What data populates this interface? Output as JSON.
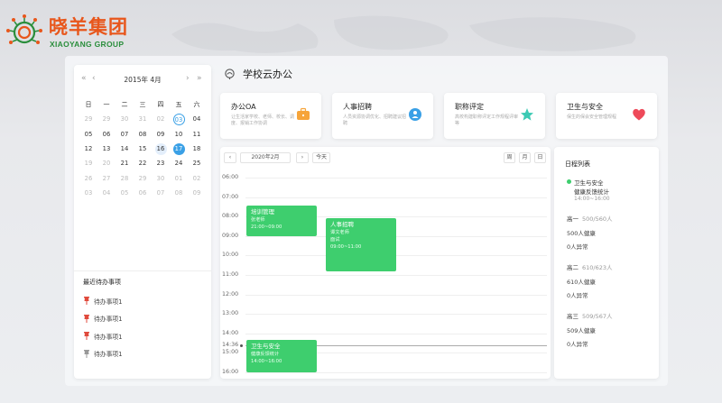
{
  "brand": {
    "name_cn": "晓羊集团",
    "name_en": "XIAOYANG GROUP",
    "cn_color": "#e8561b",
    "en_color": "#2a8e3c"
  },
  "calendar": {
    "title": "2015年 4月",
    "nav": {
      "prev_year": "«",
      "prev_month": "‹",
      "next_month": "›",
      "next_year": "»"
    },
    "weekdays": [
      "日",
      "一",
      "二",
      "三",
      "四",
      "五",
      "六"
    ],
    "weeks": [
      [
        {
          "d": "29",
          "dim": true
        },
        {
          "d": "29",
          "dim": true
        },
        {
          "d": "30",
          "dim": true
        },
        {
          "d": "31",
          "dim": true
        },
        {
          "d": "02",
          "dim": true
        },
        {
          "d": "03",
          "today": true
        },
        {
          "d": "04"
        }
      ],
      [
        {
          "d": "05"
        },
        {
          "d": "06"
        },
        {
          "d": "07"
        },
        {
          "d": "08"
        },
        {
          "d": "09"
        },
        {
          "d": "10"
        },
        {
          "d": "11"
        }
      ],
      [
        {
          "d": "12"
        },
        {
          "d": "13"
        },
        {
          "d": "14"
        },
        {
          "d": "15"
        },
        {
          "d": "16",
          "hover": true
        },
        {
          "d": "17",
          "selected": true
        },
        {
          "d": "18"
        }
      ],
      [
        {
          "d": "19",
          "dim": true
        },
        {
          "d": "20",
          "dim": true
        },
        {
          "d": "21"
        },
        {
          "d": "22"
        },
        {
          "d": "23"
        },
        {
          "d": "24"
        },
        {
          "d": "25"
        }
      ],
      [
        {
          "d": "26",
          "dim": true
        },
        {
          "d": "27",
          "dim": true
        },
        {
          "d": "28",
          "dim": true
        },
        {
          "d": "29",
          "dim": true
        },
        {
          "d": "30",
          "dim": true
        },
        {
          "d": "01",
          "dim": true
        },
        {
          "d": "02",
          "dim": true
        }
      ],
      [
        {
          "d": "03",
          "dim": true
        },
        {
          "d": "04",
          "dim": true
        },
        {
          "d": "05",
          "dim": true
        },
        {
          "d": "06",
          "dim": true
        },
        {
          "d": "07",
          "dim": true
        },
        {
          "d": "08",
          "dim": true
        },
        {
          "d": "09",
          "dim": true
        }
      ]
    ],
    "accent": "#3aa0e6"
  },
  "todos": {
    "title": "最近待办事项",
    "items": [
      {
        "label": "待办事项1",
        "color": "#e04a3c"
      },
      {
        "label": "待办事项1",
        "color": "#e04a3c"
      },
      {
        "label": "待办事项1",
        "color": "#e04a3c"
      },
      {
        "label": "待办事项1",
        "color": "#999999"
      }
    ]
  },
  "main": {
    "title": "学校云办公",
    "cards": [
      {
        "title": "办公OA",
        "desc": "让生活家学校、老师、校长、调度、报销工作协调",
        "icon": "briefcase-icon",
        "color": "#f6a43a"
      },
      {
        "title": "人事招聘",
        "desc": "人员资源协调优化、招聘建议招聘",
        "icon": "badge-icon",
        "color": "#3aa0e6"
      },
      {
        "title": "职称评定",
        "desc": "高校构建职称评定工作规程评审等",
        "icon": "star-icon",
        "color": "#3ccab4"
      },
      {
        "title": "卫生与安全",
        "desc": "保生的保会安全管理规程",
        "icon": "heart-icon",
        "color": "#ee4a5a"
      }
    ]
  },
  "schedule": {
    "date_label": "2020年2月",
    "prev": "‹",
    "next": "›",
    "today_label": "今天",
    "views": [
      "周",
      "月",
      "日"
    ],
    "hours": [
      "06:00",
      "07:00",
      "08:00",
      "09:00",
      "10:00",
      "11:00",
      "12:00",
      "13:00",
      "14:00",
      "15:00",
      "16:00"
    ],
    "now_label": "14:36",
    "events": [
      {
        "title": "培训管理",
        "sub1": "张老师",
        "sub2": "21:00~09:00",
        "col": 0,
        "start": 7.45,
        "end": 9.0
      },
      {
        "title": "人事招聘",
        "sub1": "谭文老师",
        "sub2": "面试",
        "sub3": "09:00~11:00",
        "col": 1,
        "start": 8.1,
        "end": 10.8
      },
      {
        "title": "卫生与安全",
        "sub1": "健康反馈统计",
        "sub2": "14:00~16:00",
        "col": 0,
        "start": 14.35,
        "end": 16.0
      }
    ]
  },
  "agenda": {
    "title": "日程列表",
    "event": {
      "title": "卫生与安全",
      "sub": "健康反馈统计",
      "time": "14:00~16:00"
    },
    "groups": [
      {
        "name": "高一",
        "count": "500/560人",
        "lines": [
          "500人健康",
          "0人异常"
        ]
      },
      {
        "name": "高二",
        "count": "610/623人",
        "lines": [
          "610人健康",
          "0人异常"
        ]
      },
      {
        "name": "高三",
        "count": "509/567人",
        "lines": [
          "509人健康",
          "0人异常"
        ]
      }
    ],
    "dot_color": "#3ece6e"
  }
}
